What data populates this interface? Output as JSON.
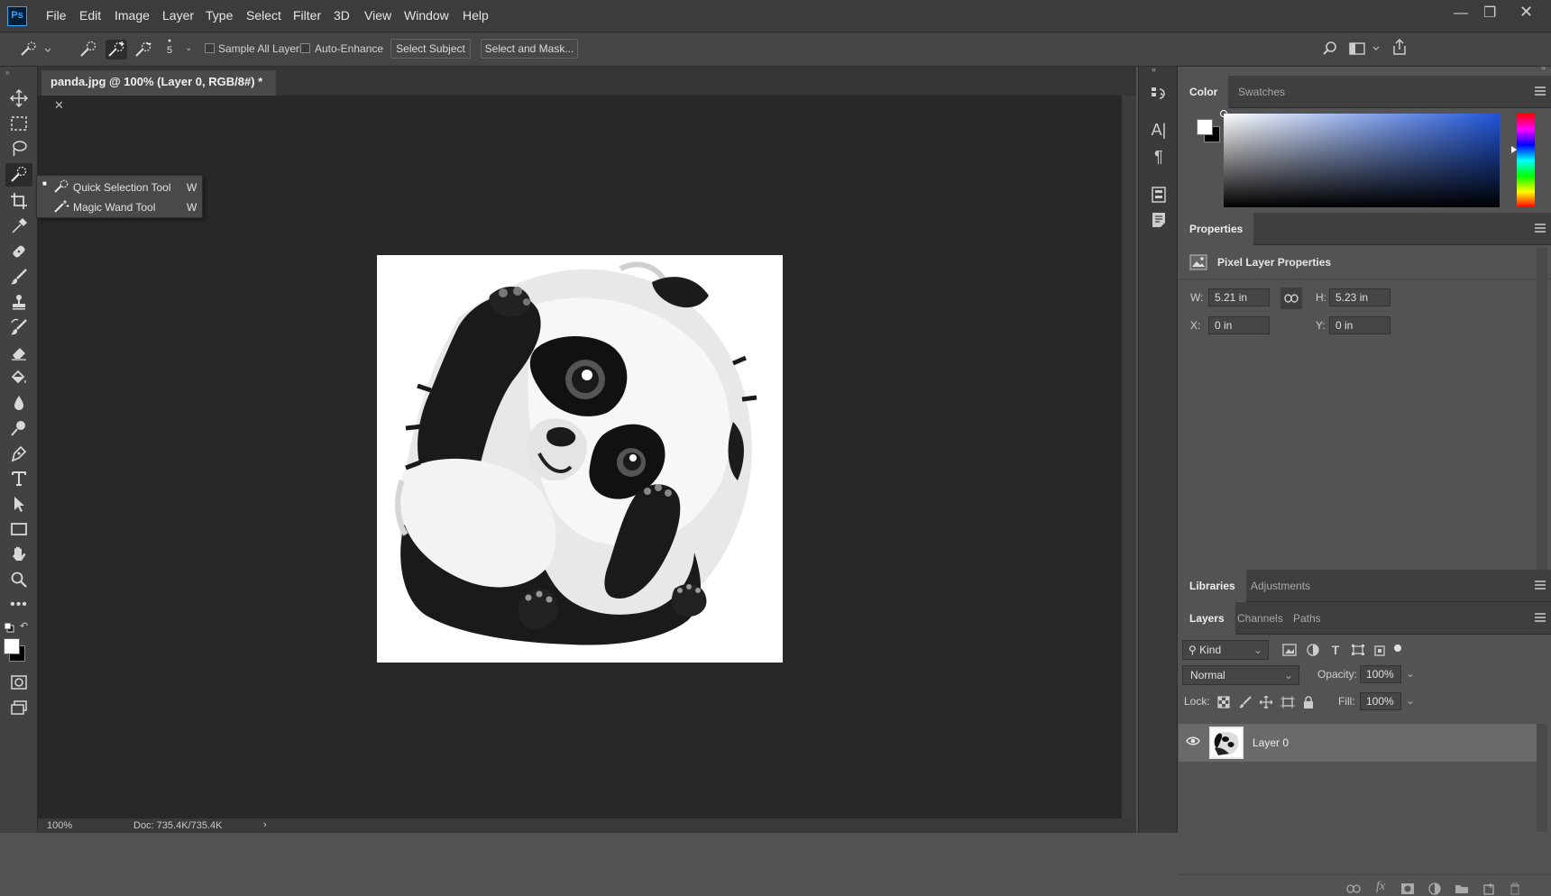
{
  "app": {
    "logo": "Ps"
  },
  "menu": [
    "File",
    "Edit",
    "Image",
    "Layer",
    "Type",
    "Select",
    "Filter",
    "3D",
    "View",
    "Window",
    "Help"
  ],
  "options_bar": {
    "brush_size": "5",
    "sample_all_layers": "Sample All Layers",
    "auto_enhance": "Auto-Enhance",
    "select_subject": "Select Subject",
    "select_and_mask": "Select and Mask..."
  },
  "flyout": [
    {
      "label": "Quick Selection Tool",
      "shortcut": "W",
      "selected": true
    },
    {
      "label": "Magic Wand Tool",
      "shortcut": "W",
      "selected": false
    }
  ],
  "document": {
    "tab_title": "panda.jpg @ 100% (Layer 0, RGB/8#) *",
    "close": "✕",
    "zoom": "100%",
    "doc_info": "Doc: 735.4K/735.4K",
    "status_arrow": "›"
  },
  "color_panel": {
    "tabs": [
      "Color",
      "Swatches"
    ]
  },
  "properties": {
    "tab": "Properties",
    "title": "Pixel Layer Properties",
    "w_label": "W:",
    "w_value": "5.21 in",
    "h_label": "H:",
    "h_value": "5.23 in",
    "x_label": "X:",
    "x_value": "0 in",
    "y_label": "Y:",
    "y_value": "0 in"
  },
  "libraries": {
    "tabs": [
      "Libraries",
      "Adjustments"
    ]
  },
  "layers_panel": {
    "tabs": [
      "Layers",
      "Channels",
      "Paths"
    ],
    "kind": "Kind",
    "blend_mode": "Normal",
    "opacity_label": "Opacity:",
    "opacity": "100%",
    "lock_label": "Lock:",
    "fill_label": "Fill:",
    "fill": "100%",
    "layers": [
      {
        "name": "Layer 0",
        "visible": true
      }
    ]
  },
  "colors": {
    "accent": "#31a8ff",
    "foreground": "#ffffff",
    "background": "#000000"
  }
}
